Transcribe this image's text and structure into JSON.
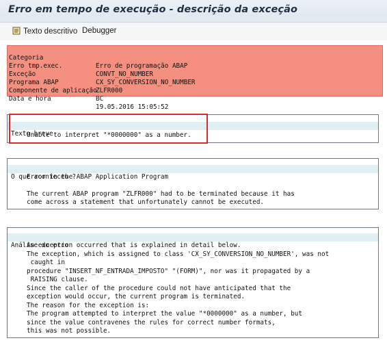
{
  "window": {
    "title": "Erro em tempo de execução - descrição da exceção"
  },
  "toolbar": {
    "text_button": "Texto descritivo",
    "debugger_button": "Debugger",
    "text_icon": "document-text-icon"
  },
  "header": {
    "rows": [
      {
        "key": "Categoria",
        "value": "Erro de programação ABAP"
      },
      {
        "key": "Erro tmp.exec.",
        "value": "CONVT_NO_NUMBER"
      },
      {
        "key": "Exceção",
        "value": "CX_SY_CONVERSION_NO_NUMBER"
      },
      {
        "key": "Programa ABAP",
        "value": "ZLFR000"
      },
      {
        "key": "Componente de aplicação",
        "value": "BC"
      },
      {
        "key": "Data e hora",
        "value": "19.05.2016 15:05:52"
      }
    ]
  },
  "short_text": {
    "heading": "Texto breve",
    "lines": [
      "Unable to interpret \"*0000000\" as a number."
    ]
  },
  "what_happened": {
    "heading": "O que aconteceu ?",
    "lines": [
      "Error in the ABAP Application Program",
      "",
      "The current ABAP program \"ZLFR000\" had to be terminated because it has",
      "come across a statement that unfortunately cannot be executed."
    ]
  },
  "error_analysis": {
    "heading": "Análise do erro",
    "lines": [
      "An exception occurred that is explained in detail below.",
      "The exception, which is assigned to class 'CX_SY_CONVERSION_NO_NUMBER', was not",
      " caught in",
      "procedure \"INSERT_NF_ENTRADA_IMPOSTO\" \"(FORM)\", nor was it propagated by a",
      " RAISING clause.",
      "Since the caller of the procedure could not have anticipated that the",
      "exception would occur, the current program is terminated.",
      "The reason for the exception is:",
      "The program attempted to interpret the value \"*0000000\" as a number, but",
      "since the value contravenes the rules for correct number formats,",
      "this was not possible."
    ]
  }
}
